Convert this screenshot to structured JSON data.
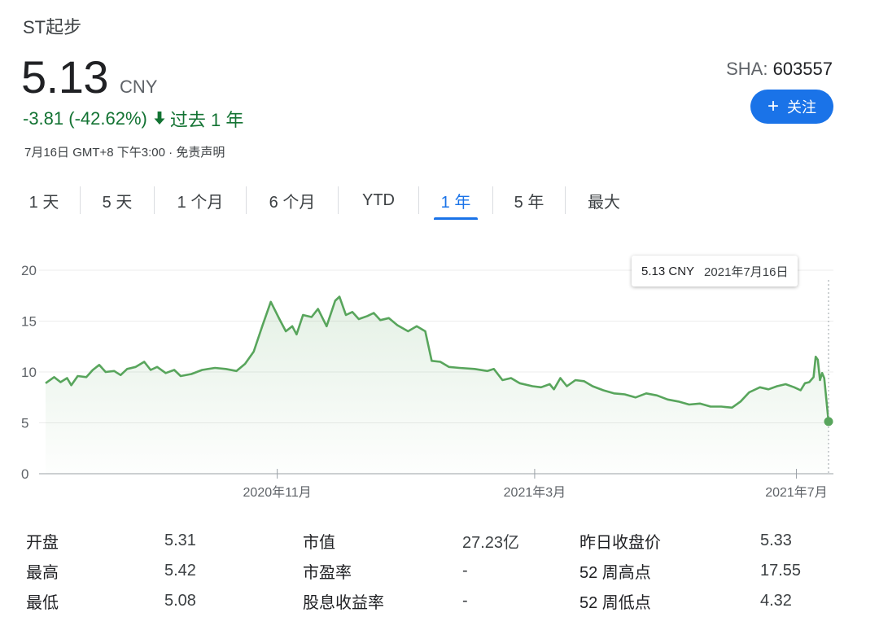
{
  "header": {
    "name": "ST起步",
    "price": "5.13",
    "currency": "CNY",
    "change": "-3.81 (-42.62%)",
    "change_arrow": "down-arrow-icon",
    "period": "过去 1 年",
    "timestamp": "7月16日 GMT+8 下午3:00 · ",
    "disclaimer": "免责声明",
    "exchange_label": "SHA: ",
    "exchange_code": "603557",
    "follow_label": "关注",
    "follow_icon": "plus-icon"
  },
  "tabs": [
    {
      "label": "1 天",
      "active": false
    },
    {
      "label": "5 天",
      "active": false
    },
    {
      "label": "1 个月",
      "active": false
    },
    {
      "label": "6 个月",
      "active": false
    },
    {
      "label": "YTD",
      "active": false
    },
    {
      "label": "1 年",
      "active": true
    },
    {
      "label": "5 年",
      "active": false
    },
    {
      "label": "最大",
      "active": false
    }
  ],
  "tooltip": {
    "price": "5.13 CNY",
    "date": "2021年7月16日"
  },
  "colors": {
    "line": "#58a55c",
    "accent": "#1a73e8",
    "positive_text": "#137333"
  },
  "chart_data": {
    "type": "area",
    "title": "",
    "xlabel": "",
    "ylabel": "",
    "ylim": [
      0,
      20
    ],
    "yticks": [
      "0",
      "5",
      "10",
      "15",
      "20"
    ],
    "x_range": [
      "2020-07-16",
      "2021-07-16"
    ],
    "xticks": [
      {
        "date": "2020-11-01",
        "label": "2020年11月"
      },
      {
        "date": "2021-03-01",
        "label": "2021年3月"
      },
      {
        "date": "2021-07-01",
        "label": "2021年7月"
      }
    ],
    "grid": true,
    "series": [
      {
        "values": [
          [
            "2020-07-16",
            8.9
          ],
          [
            "2020-07-20",
            9.5
          ],
          [
            "2020-07-23",
            9.0
          ],
          [
            "2020-07-26",
            9.4
          ],
          [
            "2020-07-28",
            8.7
          ],
          [
            "2020-07-31",
            9.6
          ],
          [
            "2020-08-04",
            9.5
          ],
          [
            "2020-08-07",
            10.2
          ],
          [
            "2020-08-10",
            10.7
          ],
          [
            "2020-08-13",
            10.0
          ],
          [
            "2020-08-17",
            10.1
          ],
          [
            "2020-08-20",
            9.7
          ],
          [
            "2020-08-23",
            10.3
          ],
          [
            "2020-08-27",
            10.5
          ],
          [
            "2020-08-31",
            11.0
          ],
          [
            "2020-09-03",
            10.2
          ],
          [
            "2020-09-06",
            10.5
          ],
          [
            "2020-09-10",
            9.9
          ],
          [
            "2020-09-14",
            10.2
          ],
          [
            "2020-09-17",
            9.6
          ],
          [
            "2020-09-22",
            9.8
          ],
          [
            "2020-09-27",
            10.2
          ],
          [
            "2020-10-03",
            10.4
          ],
          [
            "2020-10-08",
            10.3
          ],
          [
            "2020-10-13",
            10.1
          ],
          [
            "2020-10-17",
            10.8
          ],
          [
            "2020-10-21",
            12.0
          ],
          [
            "2020-10-25",
            14.5
          ],
          [
            "2020-10-29",
            16.9
          ],
          [
            "2020-11-02",
            15.2
          ],
          [
            "2020-11-05",
            14.0
          ],
          [
            "2020-11-08",
            14.5
          ],
          [
            "2020-11-10",
            13.7
          ],
          [
            "2020-11-13",
            15.6
          ],
          [
            "2020-11-17",
            15.4
          ],
          [
            "2020-11-20",
            16.2
          ],
          [
            "2020-11-24",
            14.5
          ],
          [
            "2020-11-28",
            17.0
          ],
          [
            "2020-11-30",
            17.4
          ],
          [
            "2020-12-03",
            15.6
          ],
          [
            "2020-12-06",
            15.9
          ],
          [
            "2020-12-09",
            15.2
          ],
          [
            "2020-12-13",
            15.5
          ],
          [
            "2020-12-16",
            15.8
          ],
          [
            "2020-12-19",
            15.1
          ],
          [
            "2020-12-23",
            15.3
          ],
          [
            "2020-12-27",
            14.6
          ],
          [
            "2021-01-01",
            14.0
          ],
          [
            "2021-01-05",
            14.5
          ],
          [
            "2021-01-09",
            14.0
          ],
          [
            "2021-01-12",
            11.1
          ],
          [
            "2021-01-16",
            11.0
          ],
          [
            "2021-01-20",
            10.5
          ],
          [
            "2021-01-25",
            10.4
          ],
          [
            "2021-02-01",
            10.3
          ],
          [
            "2021-02-07",
            10.1
          ],
          [
            "2021-02-10",
            10.3
          ],
          [
            "2021-02-14",
            9.2
          ],
          [
            "2021-02-18",
            9.4
          ],
          [
            "2021-02-22",
            8.9
          ],
          [
            "2021-02-28",
            8.6
          ],
          [
            "2021-03-04",
            8.5
          ],
          [
            "2021-03-08",
            8.8
          ],
          [
            "2021-03-10",
            8.3
          ],
          [
            "2021-03-13",
            9.4
          ],
          [
            "2021-03-16",
            8.6
          ],
          [
            "2021-03-20",
            9.2
          ],
          [
            "2021-03-24",
            9.1
          ],
          [
            "2021-03-28",
            8.6
          ],
          [
            "2021-04-02",
            8.2
          ],
          [
            "2021-04-07",
            7.9
          ],
          [
            "2021-04-12",
            7.8
          ],
          [
            "2021-04-17",
            7.5
          ],
          [
            "2021-04-22",
            7.9
          ],
          [
            "2021-04-27",
            7.7
          ],
          [
            "2021-05-02",
            7.3
          ],
          [
            "2021-05-07",
            7.1
          ],
          [
            "2021-05-12",
            6.8
          ],
          [
            "2021-05-17",
            6.9
          ],
          [
            "2021-05-22",
            6.6
          ],
          [
            "2021-05-27",
            6.6
          ],
          [
            "2021-06-01",
            6.5
          ],
          [
            "2021-06-05",
            7.1
          ],
          [
            "2021-06-09",
            8.0
          ],
          [
            "2021-06-14",
            8.5
          ],
          [
            "2021-06-18",
            8.3
          ],
          [
            "2021-06-22",
            8.6
          ],
          [
            "2021-06-26",
            8.8
          ],
          [
            "2021-06-30",
            8.5
          ],
          [
            "2021-07-03",
            8.2
          ],
          [
            "2021-07-05",
            8.9
          ],
          [
            "2021-07-07",
            9.0
          ],
          [
            "2021-07-09",
            9.5
          ],
          [
            "2021-07-10",
            11.5
          ],
          [
            "2021-07-11",
            11.2
          ],
          [
            "2021-07-12",
            9.2
          ],
          [
            "2021-07-13",
            9.9
          ],
          [
            "2021-07-14",
            9.4
          ],
          [
            "2021-07-16",
            5.13
          ]
        ]
      }
    ]
  },
  "stats": [
    [
      {
        "label": "开盘",
        "value": "5.31"
      },
      {
        "label": "市值",
        "value": "27.23亿"
      },
      {
        "label": "昨日收盘价",
        "value": "5.33"
      }
    ],
    [
      {
        "label": "最高",
        "value": "5.42"
      },
      {
        "label": "市盈率",
        "value": "-"
      },
      {
        "label": "52 周高点",
        "value": "17.55"
      }
    ],
    [
      {
        "label": "最低",
        "value": "5.08"
      },
      {
        "label": "股息收益率",
        "value": "-"
      },
      {
        "label": "52 周低点",
        "value": "4.32"
      }
    ]
  ]
}
